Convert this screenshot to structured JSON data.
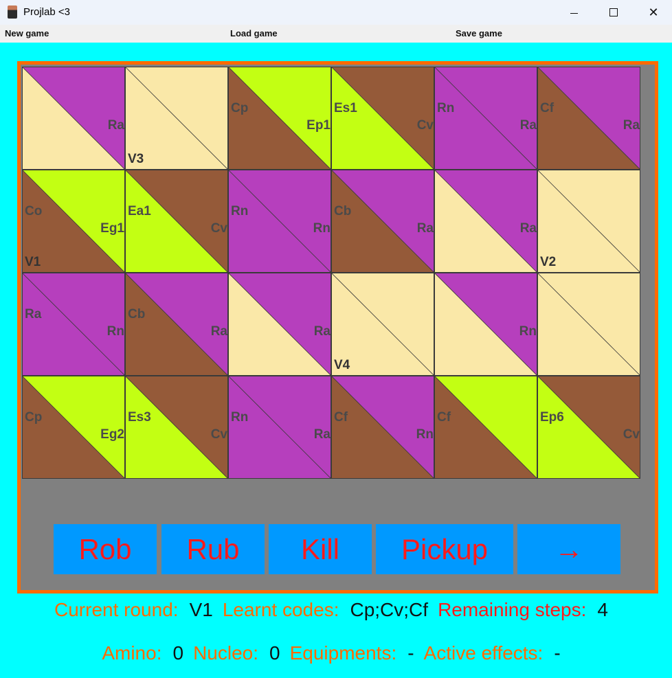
{
  "window": {
    "title": "Projlab <3",
    "minimize": "—",
    "maximize": "☐",
    "close": "✕"
  },
  "menu": {
    "new_game": "New game",
    "load_game": "Load game",
    "save_game": "Save game"
  },
  "colors": {
    "cream": "#fae8a8",
    "purple": "#b63fbd",
    "brown": "#955a39",
    "lime": "#c3ff13",
    "frame": "#ff6a00",
    "button": "#0099ff",
    "button_text": "#ff1a1a"
  },
  "board": {
    "rows": [
      [
        {
          "a": "cream",
          "b": "purple",
          "tl": "",
          "br": "Ra",
          "v": ""
        },
        {
          "a": "cream",
          "b": "cream",
          "tl": "",
          "br": "",
          "v": "V3"
        },
        {
          "a": "brown",
          "b": "lime",
          "tl": "Cp",
          "br": "Ep1",
          "v": ""
        },
        {
          "a": "lime",
          "b": "brown",
          "tl": "Es1",
          "br": "Cv",
          "v": ""
        },
        {
          "a": "purple",
          "b": "purple",
          "tl": "Rn",
          "br": "Ra",
          "v": ""
        },
        {
          "a": "brown",
          "b": "purple",
          "tl": "Cf",
          "br": "Ra",
          "v": ""
        }
      ],
      [
        {
          "a": "brown",
          "b": "lime",
          "tl": "Co",
          "br": "Eg1",
          "v": "V1"
        },
        {
          "a": "lime",
          "b": "brown",
          "tl": "Ea1",
          "br": "Cv",
          "v": ""
        },
        {
          "a": "purple",
          "b": "purple",
          "tl": "Rn",
          "br": "Rn",
          "v": ""
        },
        {
          "a": "brown",
          "b": "purple",
          "tl": "Cb",
          "br": "Ra",
          "v": ""
        },
        {
          "a": "cream",
          "b": "purple",
          "tl": "",
          "br": "Ra",
          "v": ""
        },
        {
          "a": "cream",
          "b": "cream",
          "tl": "",
          "br": "",
          "v": "V2"
        }
      ],
      [
        {
          "a": "purple",
          "b": "purple",
          "tl": "Ra",
          "br": "Rn",
          "v": ""
        },
        {
          "a": "brown",
          "b": "purple",
          "tl": "Cb",
          "br": "Ra",
          "v": ""
        },
        {
          "a": "cream",
          "b": "purple",
          "tl": "",
          "br": "Ra",
          "v": ""
        },
        {
          "a": "cream",
          "b": "cream",
          "tl": "",
          "br": "",
          "v": "V4"
        },
        {
          "a": "cream",
          "b": "purple",
          "tl": "",
          "br": "Rn",
          "v": ""
        },
        {
          "a": "cream",
          "b": "cream",
          "tl": "",
          "br": "",
          "v": ""
        }
      ],
      [
        {
          "a": "brown",
          "b": "lime",
          "tl": "Cp",
          "br": "Eg2",
          "v": ""
        },
        {
          "a": "lime",
          "b": "brown",
          "tl": "Es3",
          "br": "Cv",
          "v": ""
        },
        {
          "a": "purple",
          "b": "purple",
          "tl": "Rn",
          "br": "Ra",
          "v": ""
        },
        {
          "a": "brown",
          "b": "purple",
          "tl": "Cf",
          "br": "Rn",
          "v": ""
        },
        {
          "a": "brown",
          "b": "lime",
          "tl": "Cf",
          "br": "",
          "v": ""
        },
        {
          "a": "lime",
          "b": "brown",
          "tl": "Ep6",
          "br": "Cv",
          "v": ""
        }
      ]
    ]
  },
  "actions": {
    "rob": "Rob",
    "rub": "Rub",
    "kill": "Kill",
    "pickup": "Pickup",
    "next": "→"
  },
  "status": {
    "current_round_label": "Current round:",
    "current_round": "V1",
    "learnt_codes_label": "Learnt codes:",
    "learnt_codes": "Cp;Cv;Cf",
    "remaining_steps_label": "Remaining steps:",
    "remaining_steps": "4",
    "amino_label": "Amino:",
    "amino": "0",
    "nucleo_label": "Nucleo:",
    "nucleo": "0",
    "equipments_label": "Equipments:",
    "equipments": "-",
    "active_effects_label": "Active effects:",
    "active_effects": "-"
  }
}
